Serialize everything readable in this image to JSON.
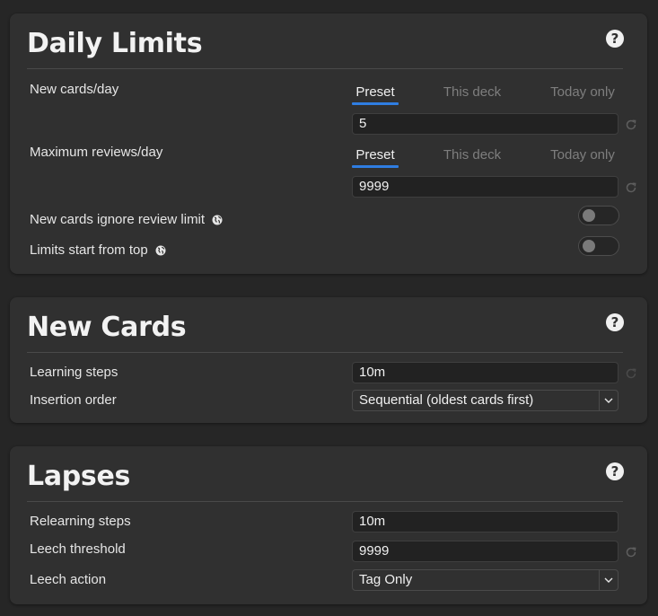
{
  "daily_limits": {
    "title": "Daily Limits",
    "help": "?",
    "new_cards": {
      "label": "New cards/day",
      "tabs": [
        "Preset",
        "This deck",
        "Today only"
      ],
      "active_tab": "Preset",
      "value": "5"
    },
    "max_reviews": {
      "label": "Maximum reviews/day",
      "tabs": [
        "Preset",
        "This deck",
        "Today only"
      ],
      "active_tab": "Preset",
      "value": "9999"
    },
    "ignore_review_limit": {
      "label": "New cards ignore review limit",
      "enabled": false
    },
    "limits_from_top": {
      "label": "Limits start from top",
      "enabled": false
    }
  },
  "new_cards": {
    "title": "New Cards",
    "help": "?",
    "learning_steps": {
      "label": "Learning steps",
      "value": "10m"
    },
    "insertion_order": {
      "label": "Insertion order",
      "value": "Sequential (oldest cards first)"
    }
  },
  "lapses": {
    "title": "Lapses",
    "help": "?",
    "relearning_steps": {
      "label": "Relearning steps",
      "value": "10m"
    },
    "leech_threshold": {
      "label": "Leech threshold",
      "value": "9999"
    },
    "leech_action": {
      "label": "Leech action",
      "value": "Tag Only"
    }
  },
  "colors": {
    "background": "#262626",
    "card": "#303030",
    "accent": "#2f7de1",
    "text": "#e6e6e6",
    "muted": "#7e7e7e"
  },
  "icons": [
    "help-icon",
    "globe-icon",
    "revert-icon",
    "chevron-down-icon"
  ]
}
